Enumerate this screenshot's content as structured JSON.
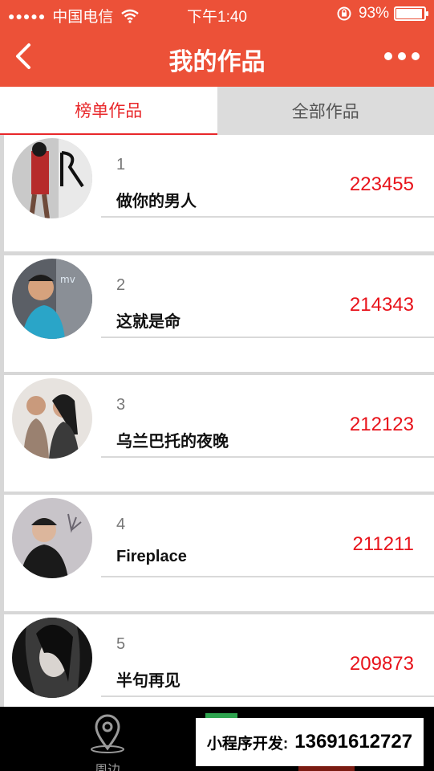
{
  "status_bar": {
    "signal": "●●●●●",
    "carrier": "中国电信",
    "time": "下午1:40",
    "battery_text": "93%",
    "battery_level": 0.93
  },
  "nav": {
    "title": "我的作品"
  },
  "tabs": [
    {
      "label": "榜单作品",
      "active": true
    },
    {
      "label": "全部作品",
      "active": false
    }
  ],
  "items": [
    {
      "rank": "1",
      "song": "做你的男人",
      "score": "223455"
    },
    {
      "rank": "2",
      "song": "这就是命",
      "score": "214343"
    },
    {
      "rank": "3",
      "song": "乌兰巴托的夜晚",
      "score": "212123"
    },
    {
      "rank": "4",
      "song": "Fireplace",
      "score": "211211"
    },
    {
      "rank": "5",
      "song": "半句再见",
      "score": "209873"
    }
  ],
  "tab_bar": {
    "nearby_label": "周边"
  },
  "promo": {
    "label": "小程序开发:",
    "phone": "13691612727"
  },
  "colors": {
    "brand": "#ec5138",
    "score": "#e8131b",
    "active_tab": "#e8272a"
  }
}
